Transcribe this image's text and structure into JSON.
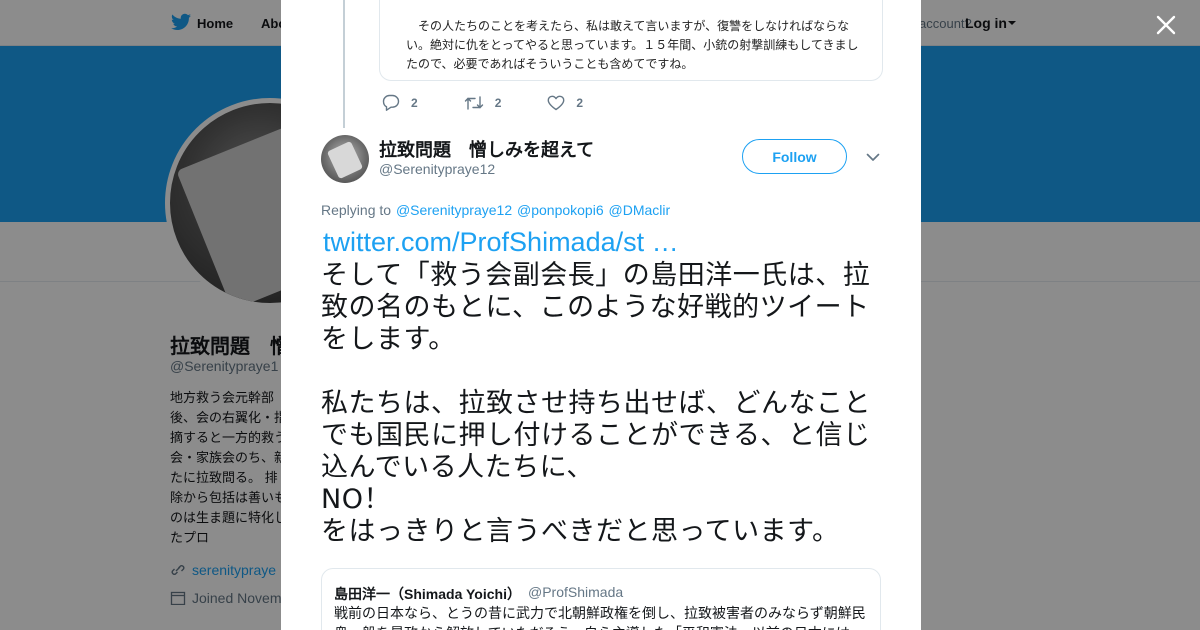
{
  "nav": {
    "home_label": "Home",
    "about_label": "Abo",
    "account_prompt": "account?",
    "login_label": "Log in"
  },
  "profile": {
    "name": "拉致問題　憎",
    "handle": "@Serenitypraye1",
    "bio": "地方救う会元幹部後、会の右翼化・指摘すると一方的救う会・家族会のち、新たに拉致問る。 排除から包括は善いものは生ま題に特化したプロ",
    "website": "serenitypraye",
    "joined": "Joined Novem"
  },
  "modal": {
    "close_icon": "close-icon",
    "prev_quote_text": "その人たちのことを考えたら、私は敢えて言いますが、復讐をしなければならない。絶対に仇をとってやると思っています。１５年間、小銃の射撃訓練もしてきましたので、必要であればそういうことも含めてですね。",
    "prev_actions": {
      "reply_count": "2",
      "retweet_count": "2",
      "like_count": "2"
    },
    "tweet": {
      "name": "拉致問題　憎しみを超えて",
      "handle": "@Serenitypraye12",
      "follow_label": "Follow",
      "replying_prefix": "Replying to",
      "mentions": [
        "@Serenitypraye12",
        "@ponpokopi6",
        "@DMaclir"
      ],
      "link": "twitter.com/ProfShimada/st …",
      "text": "そして「救う会副会長」の島田洋一氏は、拉致の名のもとに、このような好戦的ツイートをします。\n\n私たちは、拉致させ持ち出せば、どんなことでも国民に押し付けることができる、と信じ込んでいる人たちに、\nNO！\nをはっきりと言うべきだと思っています。"
    },
    "quote": {
      "name": "島田洋一（Shimada Yoichi）",
      "handle": "@ProfShimada",
      "text": "戦前の日本なら、とうの昔に武力で北朝鮮政権を倒し、拉致被害者のみならず朝鮮民衆一般を暴政から解放していただろう。自ら主導した「平和憲法」以前の日本には"
    }
  },
  "colors": {
    "brand_blue": "#1da1f2",
    "text_primary": "#14171a",
    "text_secondary": "#657786"
  }
}
